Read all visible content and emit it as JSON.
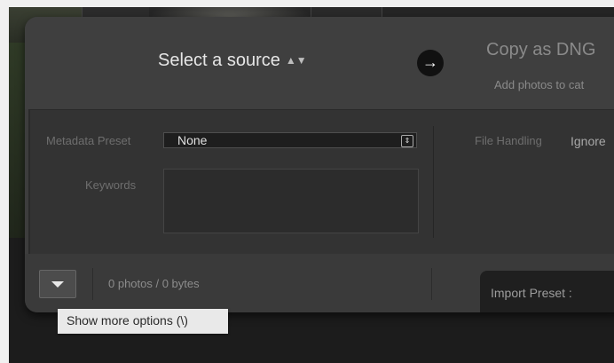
{
  "header": {
    "source_label": "Select a source",
    "copy_title": "Copy as DNG",
    "copy_subtitle": "Add photos to cat"
  },
  "metadata": {
    "preset_label": "Metadata Preset",
    "preset_value": "None",
    "keywords_label": "Keywords",
    "keywords_value": ""
  },
  "file_handling": {
    "label": "File Handling",
    "value": "Ignore"
  },
  "footer": {
    "status": "0 photos / 0 bytes",
    "import_preset_label": "Import Preset :"
  },
  "tooltip": {
    "text": "Show more options (\\)"
  },
  "icons": {
    "source_arrows": "up-down-arrows-icon",
    "go": "arrow-right-icon",
    "expand": "triangle-down-icon"
  },
  "colors": {
    "dialog_bg": "#3d3d3d",
    "panel_bg": "#333333",
    "text_primary": "#e6e6e6",
    "text_muted": "#6e6e6e"
  }
}
